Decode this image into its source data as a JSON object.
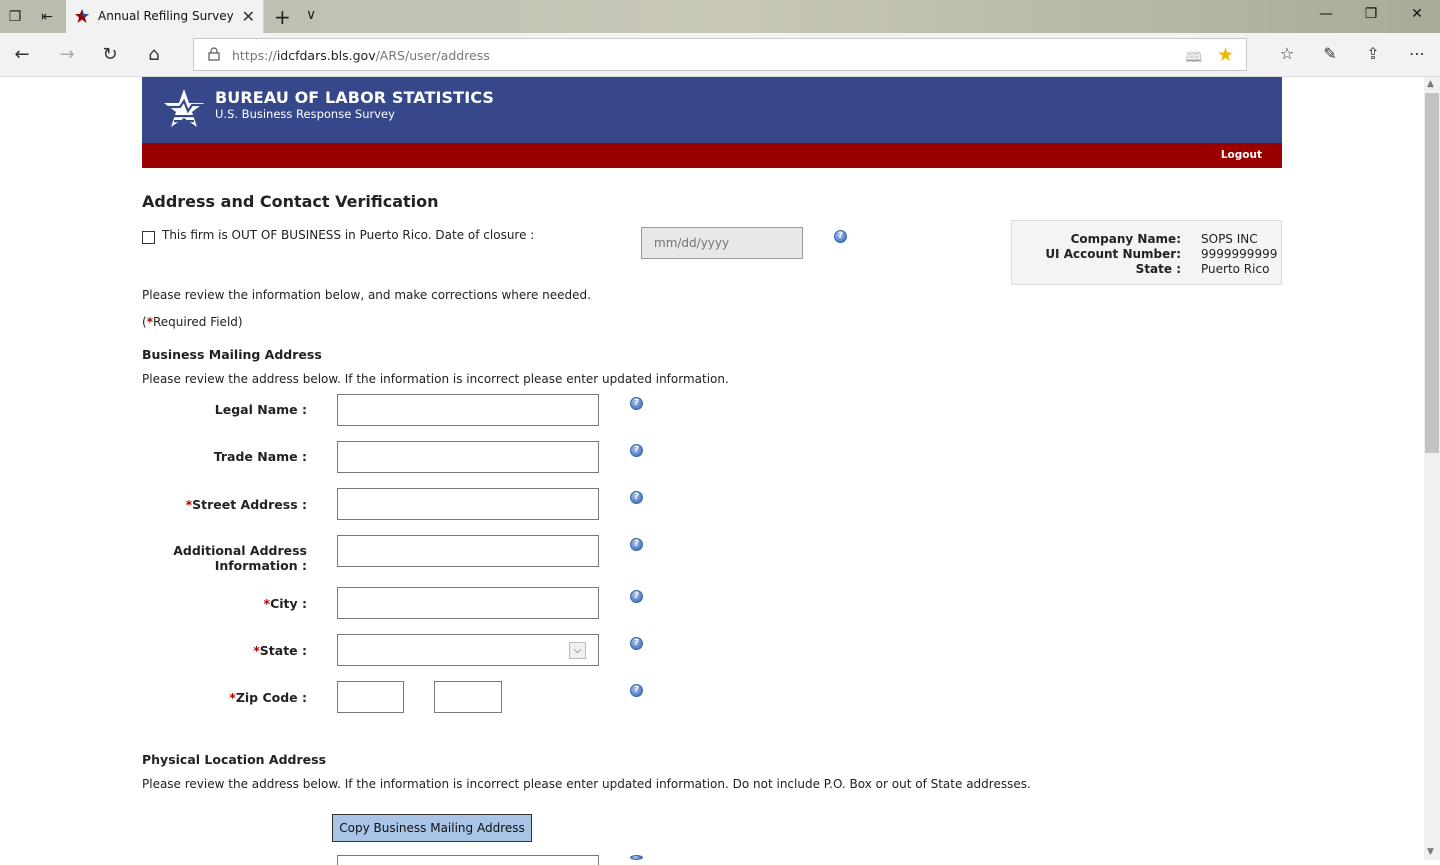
{
  "browser": {
    "tab_title": "Annual Refiling Survey -",
    "url_prefix": "https://",
    "url_host": "idcfdars.bls.gov",
    "url_path": "/ARS/user/address"
  },
  "header": {
    "agency": "BUREAU OF LABOR STATISTICS",
    "survey": "U.S. Business Response Survey",
    "logout": "Logout"
  },
  "page": {
    "title": "Address and Contact Verification",
    "out_of_business_label": "This firm is OUT OF BUSINESS in Puerto Rico. Date of closure :",
    "date_placeholder": "mm/dd/yyyy",
    "review_text": "Please review the information below, and make corrections where needed.",
    "required_open": "(",
    "required_star": "*",
    "required_text": "Required Field)"
  },
  "company_info": {
    "company_name_label": "Company Name:",
    "company_name": "SOPS INC",
    "ui_account_label": "UI Account Number:",
    "ui_account": "9999999999",
    "state_label": "State :",
    "state": "Puerto Rico"
  },
  "mailing": {
    "heading": "Business Mailing Address",
    "instructions": "Please review the address below. If the information is incorrect please enter updated information.",
    "legal_name_label": "Legal Name :",
    "trade_name_label": "Trade Name :",
    "street_label": "Street Address :",
    "additional_label_1": "Additional Address",
    "additional_label_2": "Information :",
    "city_label": "City :",
    "state_label": "State :",
    "zip_label": "Zip Code :",
    "star": "*"
  },
  "physical": {
    "heading": "Physical Location Address",
    "instructions": "Please review the address below. If the information is incorrect please enter updated information. Do not include P.O. Box or out of State addresses.",
    "copy_button": "Copy Business Mailing Address"
  }
}
